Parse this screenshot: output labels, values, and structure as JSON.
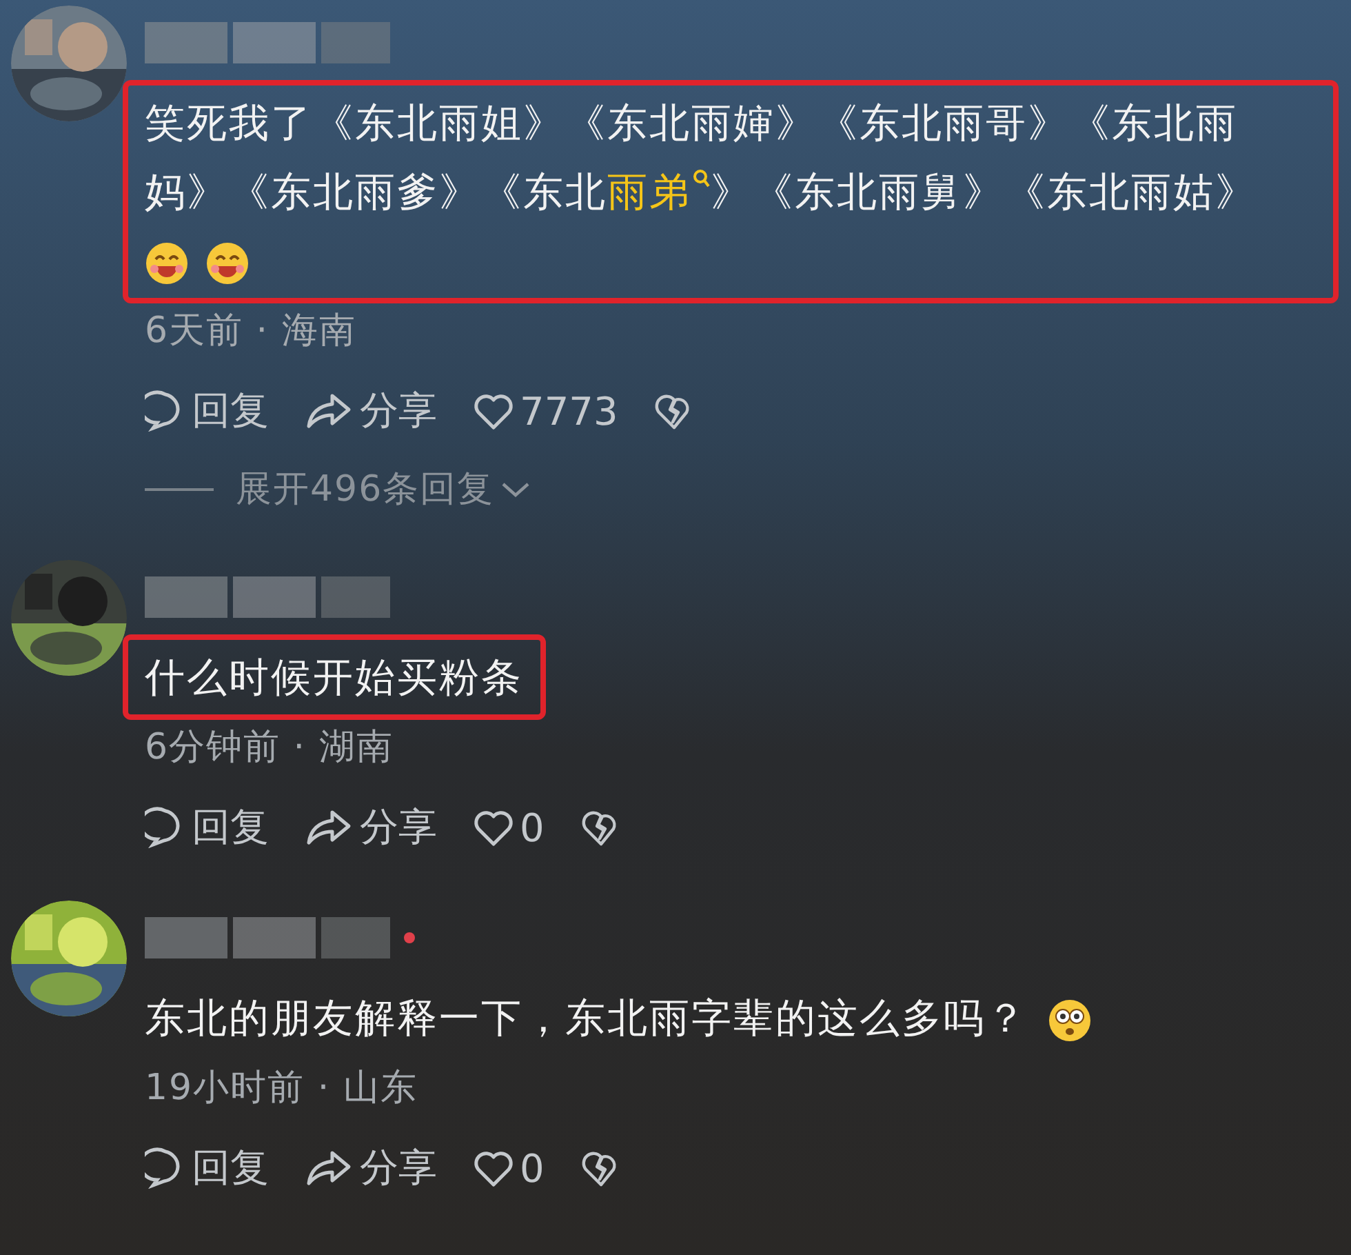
{
  "comments": [
    {
      "annotated": true,
      "segments": [
        {
          "kind": "plain",
          "text": "笑死我了《东北雨姐》《东北雨婶》《东北雨哥》《东北雨妈》《东北雨爹》《东北"
        },
        {
          "kind": "search-link",
          "text": "雨弟"
        },
        {
          "kind": "plain",
          "text": "》《东北雨舅》《东北雨姑》"
        }
      ],
      "emojis": [
        {
          "kind": "grin"
        },
        {
          "kind": "grin"
        }
      ],
      "meta": "6天前 · 海南",
      "reply": "回复",
      "share": "分享",
      "likes": "7773",
      "expand": "展开496条回复"
    },
    {
      "annotated": true,
      "segments": [
        {
          "kind": "plain",
          "text": "什么时候开始买粉条"
        }
      ],
      "meta": "6分钟前 · 湖南",
      "reply": "回复",
      "share": "分享",
      "likes": "0"
    },
    {
      "annotated": false,
      "segments": [
        {
          "kind": "plain",
          "text": "东北的朋友解释一下，东北雨字辈的这么多吗？"
        }
      ],
      "emojis": [
        {
          "kind": "dazed"
        }
      ],
      "meta": "19小时前 · 山东",
      "reply": "回复",
      "share": "分享",
      "likes": "0"
    }
  ]
}
